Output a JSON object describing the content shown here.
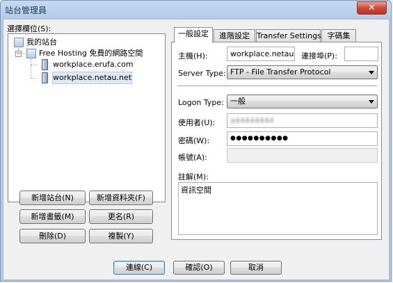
{
  "window": {
    "title": "站台管理員",
    "close": "✕"
  },
  "left": {
    "select_label": "選擇欄位(S):",
    "tree": {
      "root": "我的站台",
      "folder": "Free Hosting 免費的網路空間",
      "sites": [
        "workplace.erufa.com",
        "workplace.netau.net"
      ]
    },
    "buttons": {
      "new_site": "新增站台(N)",
      "new_folder": "新增資料夾(F)",
      "new_bookmark": "新增書籤(M)",
      "rename": "更名(R)",
      "delete": "刪除(D)",
      "copy": "複製(Y)"
    }
  },
  "tabs": [
    "一般設定",
    "進階設定",
    "Transfer Settings",
    "字碼集"
  ],
  "general": {
    "host_label": "主機(H):",
    "host_value": "workplace.netau.ne",
    "port_label": "連接埠(P):",
    "port_value": "",
    "server_type_label": "Server Type:",
    "server_type_value": "FTP - File Transfer Protocol",
    "logon_type_label": "Logon Type:",
    "logon_type_value": "一般",
    "user_label": "使用者(U):",
    "user_value": "a44444444",
    "password_label": "密碼(W):",
    "password_value": "●●●●●●●●●●",
    "account_label": "帳號(A):",
    "account_value": "",
    "comments_label": "註解(M):",
    "comments_value": "資訊空間"
  },
  "footer": {
    "connect": "連線(C)",
    "ok": "確認(O)",
    "cancel": "取消"
  }
}
